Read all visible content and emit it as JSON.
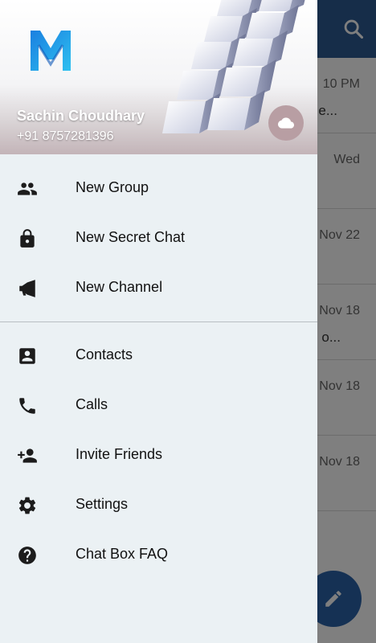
{
  "background": {
    "rows": [
      {
        "time": "10 PM",
        "snippet": "e..."
      },
      {
        "time": "Wed",
        "snippet": ""
      },
      {
        "time": "Nov 22",
        "snippet": ""
      },
      {
        "time": "Nov 18",
        "snippet": "o..."
      },
      {
        "time": "Nov 18",
        "snippet": ""
      },
      {
        "time": "Nov 18",
        "snippet": ""
      }
    ]
  },
  "drawer": {
    "user": {
      "name": "Sachin Choudhary",
      "phone": "+91 8757281396"
    },
    "menu_top": [
      {
        "label": "New Group",
        "icon": "group-icon"
      },
      {
        "label": "New Secret Chat",
        "icon": "lock-icon"
      },
      {
        "label": "New Channel",
        "icon": "megaphone-icon"
      }
    ],
    "menu_bottom": [
      {
        "label": "Contacts",
        "icon": "contacts-icon"
      },
      {
        "label": "Calls",
        "icon": "phone-icon"
      },
      {
        "label": "Invite Friends",
        "icon": "add-person-icon"
      },
      {
        "label": "Settings",
        "icon": "gear-icon"
      },
      {
        "label": "Chat Box FAQ",
        "icon": "help-icon"
      }
    ]
  },
  "colors": {
    "toolbar": "#2d5b92",
    "drawer_bg": "#ebf1f4",
    "fab": "#2b63a8"
  }
}
